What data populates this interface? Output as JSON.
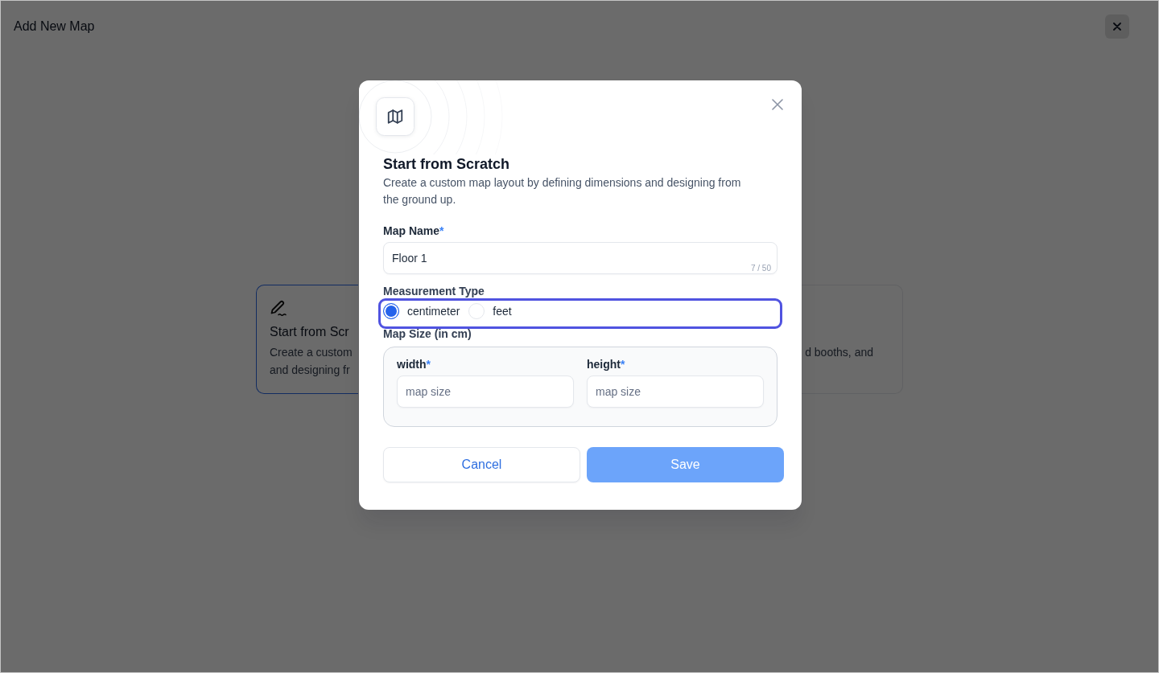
{
  "page": {
    "title": "Add New Map"
  },
  "options": [
    {
      "title": "Start from Scr",
      "description_lines": [
        "Create a custom",
        "and designing fr"
      ],
      "selected": true
    },
    {
      "description_lines": [
        "d booths, and"
      ],
      "selected": false
    }
  ],
  "dialog": {
    "title": "Start from Scratch",
    "description": "Create a custom map layout by defining dimensions and designing from the ground up.",
    "map_name": {
      "label": "Map Name",
      "required_mark": "*",
      "value": "Floor 1",
      "counter": "7 / 50"
    },
    "measurement": {
      "label": "Measurement Type",
      "focused": true,
      "options": [
        {
          "label": "centimeter",
          "selected": true
        },
        {
          "label": "feet",
          "selected": false
        }
      ]
    },
    "map_size": {
      "label": "Map Size (in cm)",
      "fields": [
        {
          "label": "width",
          "required_mark": "*",
          "placeholder": "map size"
        },
        {
          "label": "height",
          "required_mark": "*",
          "placeholder": "map size"
        }
      ]
    },
    "buttons": [
      {
        "label": "Cancel",
        "kind": "secondary",
        "disabled": false
      },
      {
        "label": "Save",
        "kind": "primary",
        "disabled": true
      }
    ]
  }
}
